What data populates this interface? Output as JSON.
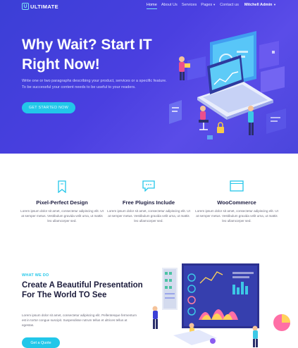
{
  "brand": {
    "logo_letter": "U",
    "name": "ULTIMATE"
  },
  "nav": {
    "items": [
      "Home",
      "About Us",
      "Services",
      "Pages",
      "Contact us"
    ],
    "active": "Home",
    "pages_has_dropdown": true,
    "user": "Mitchell Admin"
  },
  "hero": {
    "title_line1": "Why Wait? Start IT",
    "title_line2": "Right Now!",
    "description_line1": "Write one or two paragraphs describing your product, services or a specific feature.",
    "description_line2": "To be successful your content needs to be useful to your readers.",
    "button": "GET STARTED NOW"
  },
  "features": [
    {
      "icon": "bookmark-icon",
      "title": "Pixel-Perfect Design",
      "text": "Lorem ipsum dolor sit amet, consectetur adipiscing elit. Ut at semper metus. Vestibulum gravida velit urna, ut mattis leo ullamcorper sed."
    },
    {
      "icon": "chat-bubble-icon",
      "title": "Free Plugins Include",
      "text": "Lorem ipsum dolor sit amet, consectetur adipiscing elit. Ut at semper metus. Vestibulum gravida velit urna, ut mattis leo ullamcorper sed."
    },
    {
      "icon": "browser-window-icon",
      "title": "WooCommerce",
      "text": "Lorem ipsum dolor sit amet, consectetur adipiscing elit. Ut at semper metus. Vestibulum gravida velit urna, ut mattis leo ullamcorper sed."
    }
  ],
  "section2": {
    "kicker": "WHAT WE DO",
    "title": "Create A Beautiful Presentation For The World TO See",
    "description": "Lorem ipsum dolor sit amet, consectetur adipiscing elit. Pellentesque fermentum est in tortor congue suscipit. Suspendisse rutrum tellus et ultrices tellus at egestas.",
    "button": "Get a Quote"
  },
  "colors": {
    "hero_start": "#3b3fd6",
    "hero_end": "#5a4ce8",
    "accent": "#22c7e9",
    "heading": "#222244"
  }
}
